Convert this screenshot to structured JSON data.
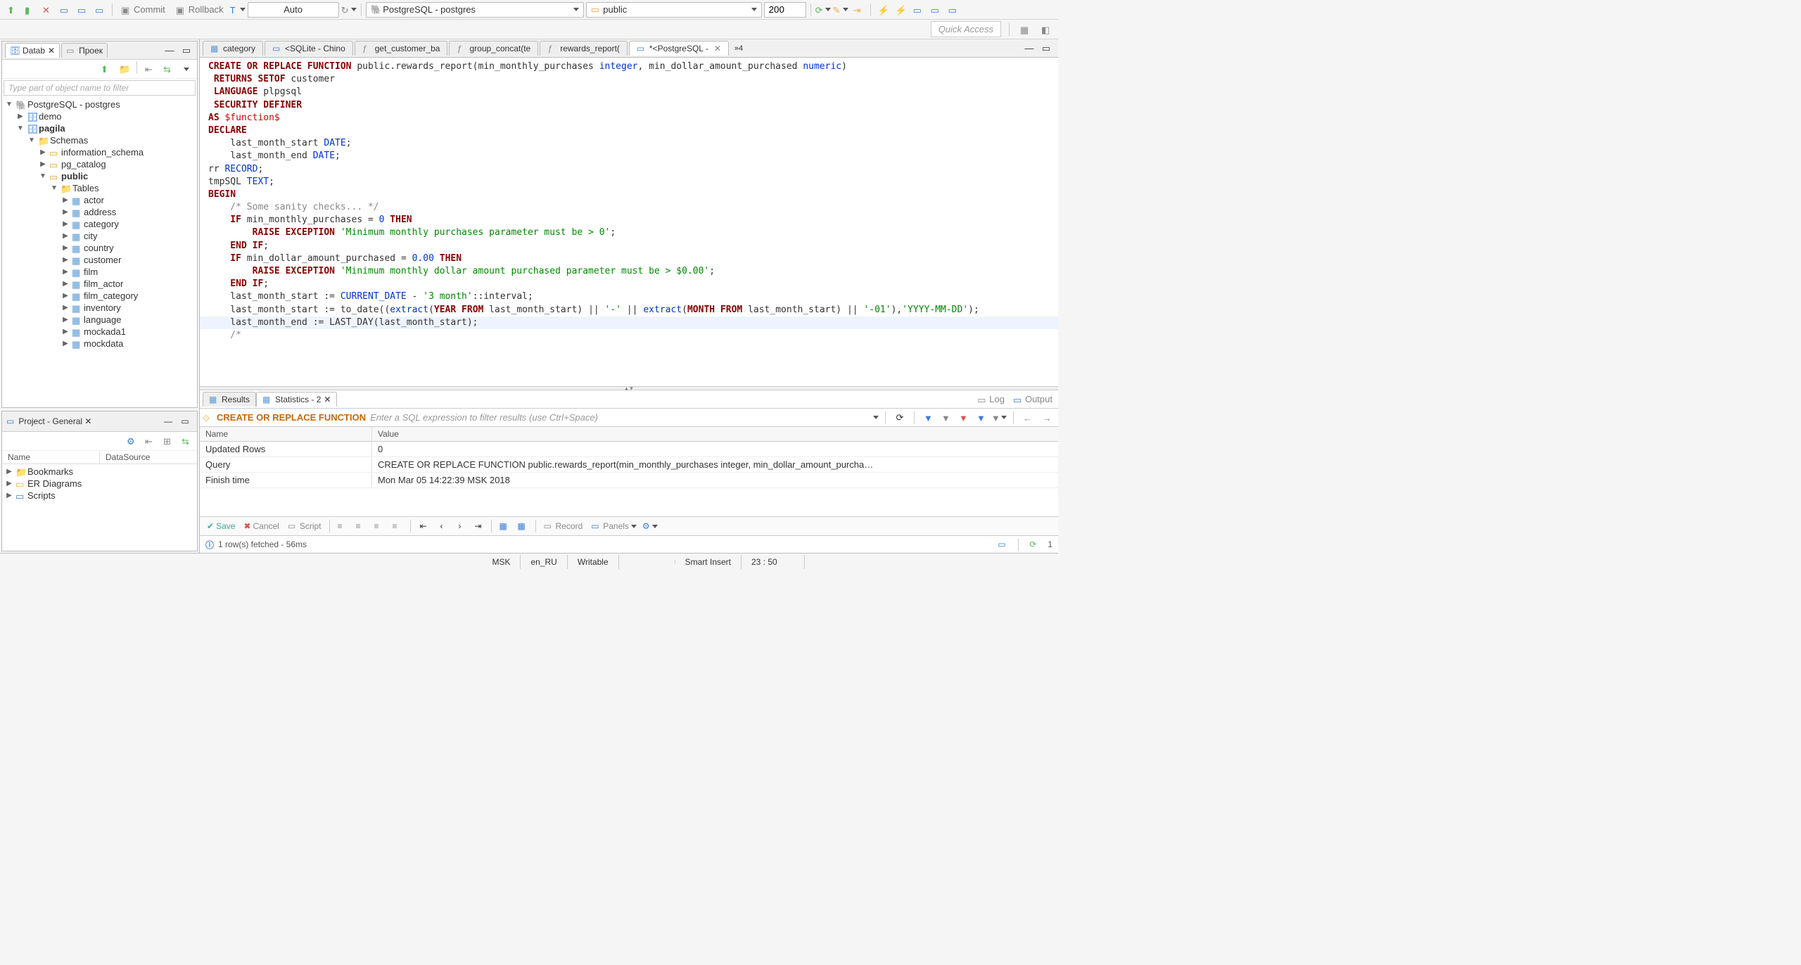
{
  "toolbar": {
    "commit_label": "Commit",
    "rollback_label": "Rollback",
    "tx_mode": "Auto",
    "connection": "PostgreSQL - postgres",
    "schema": "public",
    "row_limit": "200",
    "quick_access": "Quick Access"
  },
  "left_panel": {
    "tab_database": "Datab",
    "tab_projects": "Проек",
    "filter_placeholder": "Type part of object name to filter",
    "tree": {
      "root": "PostgreSQL - postgres",
      "db_demo": "demo",
      "db_pagila": "pagila",
      "schemas": "Schemas",
      "schema_info": "information_schema",
      "schema_pgcatalog": "pg_catalog",
      "schema_public": "public",
      "tables": "Tables",
      "t_actor": "actor",
      "t_address": "address",
      "t_category": "category",
      "t_city": "city",
      "t_country": "country",
      "t_customer": "customer",
      "t_film": "film",
      "t_film_actor": "film_actor",
      "t_film_category": "film_category",
      "t_inventory": "inventory",
      "t_language": "language",
      "t_mockada1": "mockada1",
      "t_mockdata": "mockdata"
    }
  },
  "project_panel": {
    "title": "Project - General",
    "col_name": "Name",
    "col_ds": "DataSource",
    "item_bookmarks": "Bookmarks",
    "item_er": "ER Diagrams",
    "item_scripts": "Scripts"
  },
  "editor_tabs": {
    "t1": "category",
    "t2": "<SQLite - Chino",
    "t3": "get_customer_ba",
    "t4": "group_concat(te",
    "t5": "rewards_report(",
    "t6": "*<PostgreSQL -",
    "more": "»4"
  },
  "code": {
    "l1a": "CREATE OR REPLACE FUNCTION",
    "l1b": " public.rewards_report(min_monthly_purchases ",
    "l1c": "integer",
    "l1d": ", min_dollar_amount_purchased ",
    "l1e": "numeric",
    "l1f": ")",
    "l2a": " RETURNS SETOF",
    "l2b": " customer",
    "l3a": " LANGUAGE",
    "l3b": " plpgsql",
    "l4": " SECURITY DEFINER",
    "l5a": "AS ",
    "l5b": "$function$",
    "l6": "DECLARE",
    "l7a": "    last_month_start ",
    "l7b": "DATE",
    "l7c": ";",
    "l8a": "    last_month_end ",
    "l8b": "DATE",
    "l8c": ";",
    "l9a": "rr ",
    "l9b": "RECORD",
    "l9c": ";",
    "l10a": "tmpSQL ",
    "l10b": "TEXT",
    "l10c": ";",
    "l11": "BEGIN",
    "l12": "",
    "l13": "    /* Some sanity checks... */",
    "l14a": "    IF",
    "l14b": " min_monthly_purchases = ",
    "l14c": "0",
    "l14d": " THEN",
    "l15a": "        RAISE EXCEPTION ",
    "l15b": "'Minimum monthly purchases parameter must be > 0'",
    "l15c": ";",
    "l16a": "    END",
    "l16b": " IF",
    "l16c": ";",
    "l17a": "    IF",
    "l17b": " min_dollar_amount_purchased = ",
    "l17c": "0.00",
    "l17d": " THEN",
    "l18a": "        RAISE EXCEPTION ",
    "l18b": "'Minimum monthly dollar amount purchased parameter must be > $0.00'",
    "l18c": ";",
    "l19a": "    END",
    "l19b": " IF",
    "l19c": ";",
    "l20": "",
    "l21a": "    last_month_start := ",
    "l21b": "CURRENT_DATE",
    "l21c": " - ",
    "l21d": "'3 month'",
    "l21e": "::interval;",
    "l22a": "    last_month_start := to_date((",
    "l22b": "extract",
    "l22c": "(",
    "l22d": "YEAR FROM",
    "l22e": " last_month_start) || ",
    "l22f": "'-'",
    "l22g": " || ",
    "l22h": "extract",
    "l22i": "(",
    "l22j": "MONTH FROM",
    "l22k": " last_month_start) || ",
    "l22l": "'-01'",
    "l22m": "),",
    "l22n": "'YYYY-MM-DD'",
    "l22o": ");",
    "l23a": "    last_month_end := LAST_DAY(last_month_start);",
    "l24": "",
    "l25": "    /*"
  },
  "results": {
    "tab_results": "Results",
    "tab_stats": "Statistics - 2",
    "log_btn": "Log",
    "output_btn": "Output",
    "filter_sql": "CREATE OR REPLACE FUNCTION",
    "filter_hint": "Enter a SQL expression to filter results (use Ctrl+Space)",
    "col_name": "Name",
    "col_value": "Value",
    "r1_name": "Updated Rows",
    "r1_value": "0",
    "r2_name": "Query",
    "r2_value": "CREATE OR REPLACE FUNCTION public.rewards_report(min_monthly_purchases integer, min_dollar_amount_purcha…",
    "r3_name": "Finish time",
    "r3_value": "Mon Mar 05 14:22:39 MSK 2018"
  },
  "action_bar": {
    "save": "Save",
    "cancel": "Cancel",
    "script": "Script",
    "record": "Record",
    "panels": "Panels"
  },
  "info_bar": {
    "text": "1 row(s) fetched - 56ms",
    "count": "1"
  },
  "status_bar": {
    "tz": "MSK",
    "locale": "en_RU",
    "mode": "Writable",
    "insert": "Smart Insert",
    "pos": "23 : 50"
  }
}
